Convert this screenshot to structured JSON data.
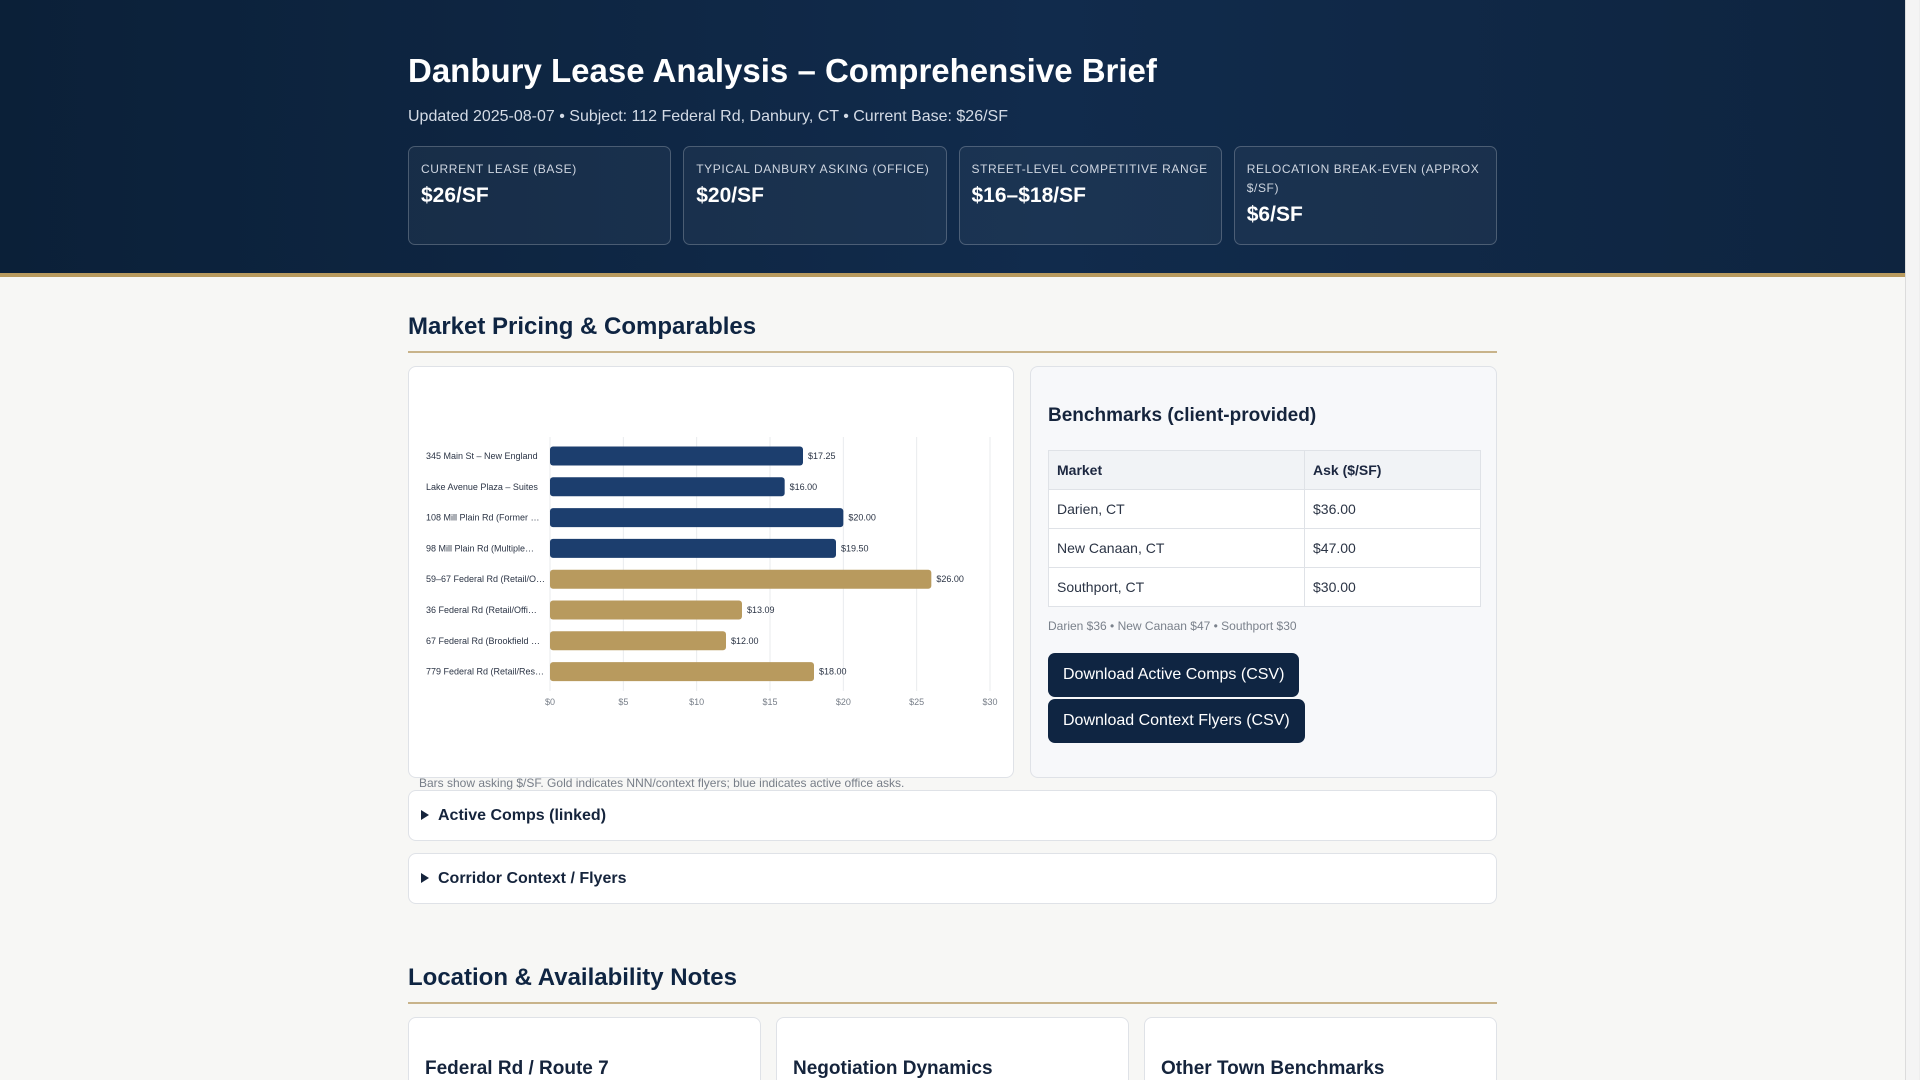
{
  "header": {
    "title": "Danbury Lease Analysis – Comprehensive Brief",
    "subtitle": "Updated 2025-08-07 • Subject: 112 Federal Rd, Danbury, CT • Current Base: $26/SF",
    "kpis": [
      {
        "label": "CURRENT LEASE (BASE)",
        "value": "$26/SF"
      },
      {
        "label": "TYPICAL DANBURY ASKING (OFFICE)",
        "value": "$20/SF"
      },
      {
        "label": "STREET-LEVEL COMPETITIVE RANGE",
        "value": "$16–$18/SF"
      },
      {
        "label": "RELOCATION BREAK-EVEN (APPROX $/SF)",
        "value": "$6/SF"
      }
    ]
  },
  "market": {
    "title": "Market Pricing & Comparables",
    "chart_caption": "Bars show asking $/SF. Gold indicates NNN/context flyers; blue indicates active office asks."
  },
  "colors": {
    "active": "#1c3e6e",
    "context": "#b89a5e",
    "grid": "#e9ebee",
    "axis_text": "#777e88"
  },
  "chart_data": {
    "type": "bar",
    "orientation": "horizontal",
    "categories": [
      "345 Main St – New England",
      "Lake Avenue Plaza – Suites",
      "108 Mill Plain Rd (Former …",
      "98 Mill Plain Rd (Multiple…",
      "59–67 Federal Rd (Retail/O…",
      "36 Federal Rd (Retail/Offi…",
      "67 Federal Rd (Brookfield …",
      "779 Federal Rd (Retail/Res…"
    ],
    "values": [
      17.25,
      16.0,
      20.0,
      19.5,
      26.0,
      13.09,
      12.0,
      18.0
    ],
    "value_labels": [
      "$17.25",
      "$16.00",
      "$20.00",
      "$19.50",
      "$26.00",
      "$13.09",
      "$12.00",
      "$18.00"
    ],
    "groups": [
      "active",
      "active",
      "active",
      "active",
      "context",
      "context",
      "context",
      "context"
    ],
    "xlim": [
      0,
      30
    ],
    "x_ticks": [
      0,
      5,
      10,
      15,
      20,
      25,
      30
    ],
    "x_tick_labels": [
      "$0",
      "$5",
      "$10",
      "$15",
      "$20",
      "$25",
      "$30"
    ],
    "grid": true,
    "title": "",
    "xlabel": "",
    "ylabel": ""
  },
  "benchmarks": {
    "title": "Benchmarks (client-provided)",
    "columns": [
      "Market",
      "Ask ($/SF)"
    ],
    "rows": [
      [
        "Darien, CT",
        "$36.00"
      ],
      [
        "New Canaan, CT",
        "$47.00"
      ],
      [
        "Southport, CT",
        "$30.00"
      ]
    ],
    "note": "Darien $36 • New Canaan $47 • Southport $30",
    "download_comps_label": "Download Active Comps (CSV)",
    "download_flyers_label": "Download Context Flyers (CSV)"
  },
  "details": {
    "active_comps": "Active Comps (linked)",
    "corridor": "Corridor Context / Flyers"
  },
  "location": {
    "title": "Location & Availability Notes",
    "cards": [
      "Federal Rd / Route 7",
      "Negotiation Dynamics",
      "Other Town Benchmarks"
    ]
  }
}
